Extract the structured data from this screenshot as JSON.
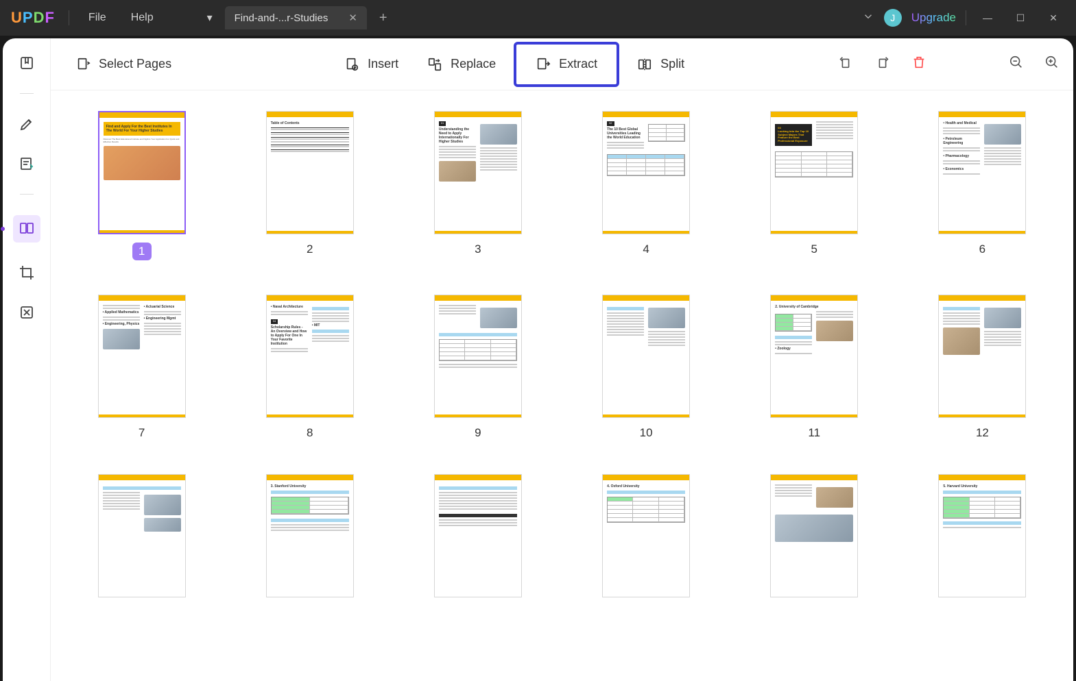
{
  "app": {
    "logo": {
      "u": "U",
      "p": "P",
      "d": "D",
      "f": "F"
    }
  },
  "menu": {
    "file": "File",
    "help": "Help"
  },
  "tab": {
    "title": "Find-and-...r-Studies"
  },
  "titlebar": {
    "avatar_initial": "J",
    "upgrade": "Upgrade"
  },
  "toolbar": {
    "select_pages": "Select Pages",
    "insert": "Insert",
    "replace": "Replace",
    "extract": "Extract",
    "split": "Split"
  },
  "pages": [
    {
      "num": "1",
      "selected": true
    },
    {
      "num": "2"
    },
    {
      "num": "3"
    },
    {
      "num": "4"
    },
    {
      "num": "5"
    },
    {
      "num": "6"
    },
    {
      "num": "7"
    },
    {
      "num": "8"
    },
    {
      "num": "9"
    },
    {
      "num": "10"
    },
    {
      "num": "11"
    },
    {
      "num": "12"
    }
  ],
  "page1": {
    "title": "Find and Apply For the Best Institutes In The World For Your Higher Studies",
    "sub": "Discover The Best Educational Institute and Digitize Your Application For Quick and Effective Results"
  },
  "page2": {
    "title": "Table of Contents"
  },
  "page3": {
    "chip": "01",
    "title": "Understanding the Need to Apply Internationally For Higher Studies"
  },
  "page4": {
    "chip": "02",
    "title": "The 10 Best Global Universities Leading the World Education"
  },
  "page5": {
    "chip": "03",
    "title": "Looking Into the Top 10 Subject Majors That Feature the Best Professional Exposure"
  },
  "page8": {
    "chip": "04",
    "title": "Scholarship Rules - An Overview and How to Apply For One In Your Favorite Institution"
  },
  "page11": {
    "title": "2. University of Cambridge"
  },
  "page14": {
    "title": "3. Stanford University"
  },
  "page15_16_17": {
    "t15": "4. Oxford University",
    "t17": "5. Harvard University"
  }
}
